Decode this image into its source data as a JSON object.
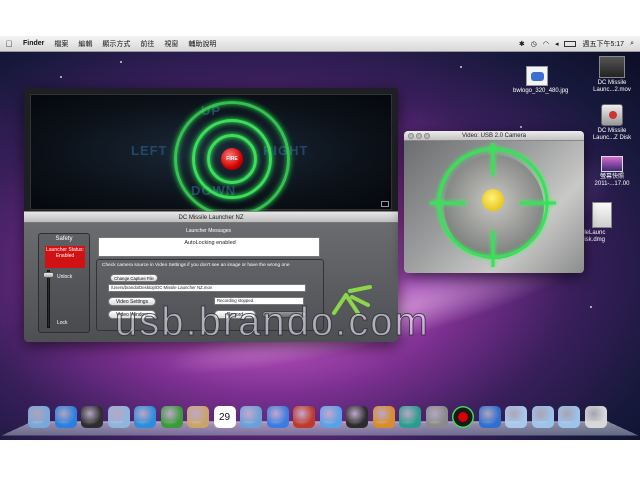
{
  "menubar": {
    "app": "Finder",
    "items": [
      "檔案",
      "編輯",
      "顯示方式",
      "前往",
      "視窗",
      "輔助說明"
    ],
    "clock": "週五下午5:17"
  },
  "desktop_icons": [
    {
      "label": "bwlogo_320_480.jpg",
      "icon": "image-file-icon"
    },
    {
      "label": "DC Missile Launc...2.mov",
      "icon": "movie-file-icon"
    },
    {
      "label": "DC Missile Launc...Z Disk",
      "icon": "disk-image-icon"
    },
    {
      "label": "螢幕快照 2011-...17.00",
      "icon": "screenshot-file-icon"
    },
    {
      "label": "sileLaunc Disk.dmg",
      "icon": "dmg-file-icon"
    }
  ],
  "launcher": {
    "title": "DC Missile Launcher NZ",
    "fire_label": "FIRE",
    "directions": {
      "up": "UP",
      "left": "LEFT",
      "right": "RIGHT",
      "down": "DOWN"
    },
    "safety": {
      "heading": "Safety",
      "status": "Launcher Status: Enabled",
      "unlock": "Unlock",
      "lock": "Lock",
      "level": 1.0
    },
    "messages_heading": "Launcher Messages",
    "message": "AutoLocking enabled",
    "camera_hint": "Check camera source in Video Settings if you don't see an image or have the wrong one",
    "change_capture_button": "Change Capture File",
    "capture_path": "/Users/brando/Desktop/DC Missile Launcher NZ.mov",
    "video_settings_button": "Video Settings",
    "recording_status": "Recording stopped.",
    "video_window_button": "Video Window",
    "record_button": "Record"
  },
  "video_window": {
    "title": "Video: USB 2.0 Camera"
  },
  "dock": {
    "items": [
      "finder-icon",
      "app-store-icon",
      "dashboard-icon",
      "mail-icon",
      "safari-icon",
      "facetime-icon",
      "address-book-icon",
      "ical-icon",
      "preview-icon",
      "itunes-icon",
      "photo-booth-icon",
      "iphoto-icon",
      "imovie-icon",
      "garageband-icon",
      "time-machine-icon",
      "system-preferences-icon",
      "missile-launcher-icon",
      "quicktime-icon",
      "applications-folder-icon",
      "documents-folder-icon",
      "downloads-folder-icon",
      "trash-icon"
    ],
    "calendar_day": "29"
  },
  "watermark": "usb.brando.com",
  "colors": {
    "ring": "#3dde5a",
    "status_red": "#d21212",
    "fire": "#d00000"
  }
}
